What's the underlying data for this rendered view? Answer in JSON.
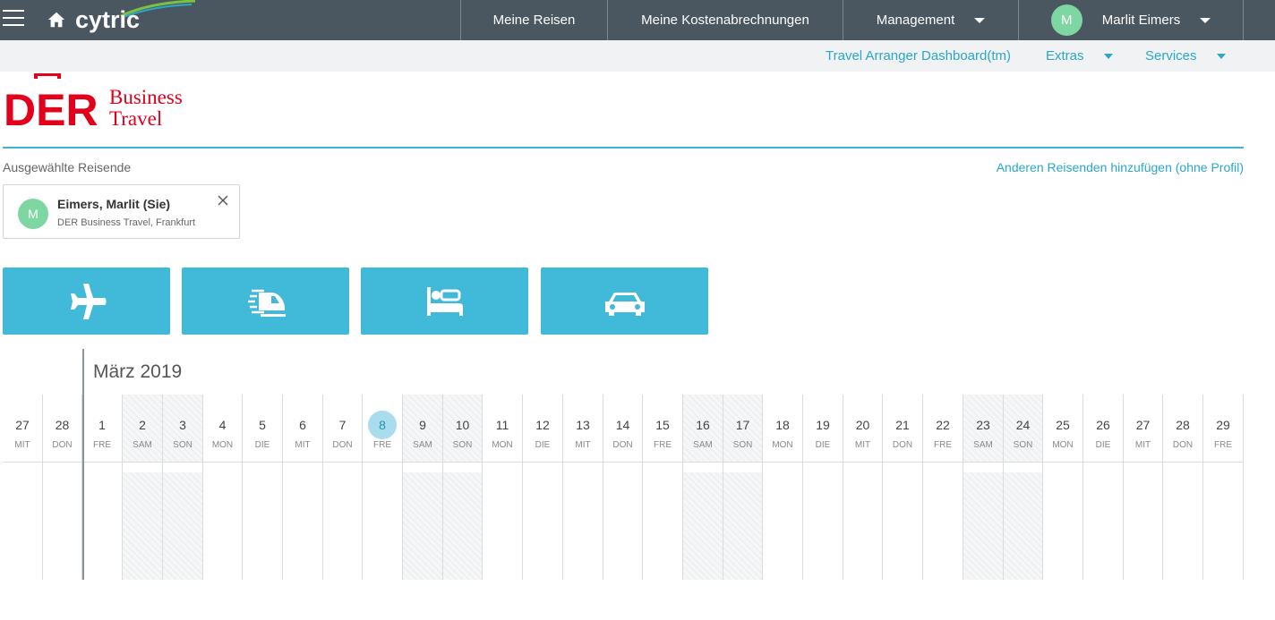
{
  "topbar": {
    "logo_text": "cytric",
    "nav": [
      {
        "label": "Meine Reisen"
      },
      {
        "label": "Meine Kostenabrechnungen"
      },
      {
        "label": "Management"
      }
    ],
    "user": {
      "initial": "M",
      "name": "Marlit Eimers"
    }
  },
  "subbar": {
    "dashboard": "Travel Arranger Dashboard(tm)",
    "extras": "Extras",
    "services": "Services"
  },
  "brand": {
    "der": "DER",
    "line1": "Business",
    "line2": "Travel",
    "color": "#e2001a"
  },
  "travellers": {
    "label": "Ausgewählte Reisende",
    "add_link": "Anderen Reisenden hinzufügen (ohne Profil)",
    "selected": {
      "initial": "M",
      "name": "Eimers, Marlit (Sie)",
      "org": "DER Business Travel, Frankfurt"
    }
  },
  "services": [
    {
      "name": "flight",
      "icon": "airplane-icon"
    },
    {
      "name": "rail",
      "icon": "train-icon"
    },
    {
      "name": "hotel",
      "icon": "bed-icon"
    },
    {
      "name": "car",
      "icon": "car-icon"
    }
  ],
  "calendar": {
    "month": "März 2019",
    "today": "8",
    "days": [
      {
        "num": "27",
        "wd": "MIT",
        "weekend": false
      },
      {
        "num": "28",
        "wd": "DON",
        "weekend": false
      },
      {
        "num": "1",
        "wd": "FRE",
        "weekend": false
      },
      {
        "num": "2",
        "wd": "SAM",
        "weekend": true
      },
      {
        "num": "3",
        "wd": "SON",
        "weekend": true
      },
      {
        "num": "4",
        "wd": "MON",
        "weekend": false
      },
      {
        "num": "5",
        "wd": "DIE",
        "weekend": false
      },
      {
        "num": "6",
        "wd": "MIT",
        "weekend": false
      },
      {
        "num": "7",
        "wd": "DON",
        "weekend": false
      },
      {
        "num": "8",
        "wd": "FRE",
        "weekend": false
      },
      {
        "num": "9",
        "wd": "SAM",
        "weekend": true
      },
      {
        "num": "10",
        "wd": "SON",
        "weekend": true
      },
      {
        "num": "11",
        "wd": "MON",
        "weekend": false
      },
      {
        "num": "12",
        "wd": "DIE",
        "weekend": false
      },
      {
        "num": "13",
        "wd": "MIT",
        "weekend": false
      },
      {
        "num": "14",
        "wd": "DON",
        "weekend": false
      },
      {
        "num": "15",
        "wd": "FRE",
        "weekend": false
      },
      {
        "num": "16",
        "wd": "SAM",
        "weekend": true
      },
      {
        "num": "17",
        "wd": "SON",
        "weekend": true
      },
      {
        "num": "18",
        "wd": "MON",
        "weekend": false
      },
      {
        "num": "19",
        "wd": "DIE",
        "weekend": false
      },
      {
        "num": "20",
        "wd": "MIT",
        "weekend": false
      },
      {
        "num": "21",
        "wd": "DON",
        "weekend": false
      },
      {
        "num": "22",
        "wd": "FRE",
        "weekend": false
      },
      {
        "num": "23",
        "wd": "SAM",
        "weekend": true
      },
      {
        "num": "24",
        "wd": "SON",
        "weekend": true
      },
      {
        "num": "25",
        "wd": "MON",
        "weekend": false
      },
      {
        "num": "26",
        "wd": "DIE",
        "weekend": false
      },
      {
        "num": "27",
        "wd": "MIT",
        "weekend": false
      },
      {
        "num": "28",
        "wd": "DON",
        "weekend": false
      },
      {
        "num": "29",
        "wd": "FRE",
        "weekend": false
      }
    ]
  }
}
